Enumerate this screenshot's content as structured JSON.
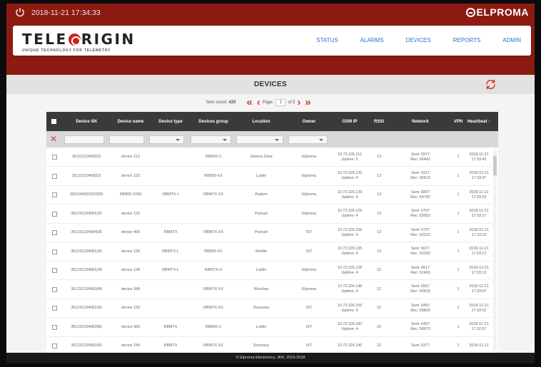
{
  "topbar": {
    "datetime": "2018-11-21 17:34:33",
    "brand": "ELPROMA",
    "colors": {
      "bar": "#8c1a12",
      "accent": "#d6392a",
      "link": "#2a72c8"
    }
  },
  "logo": {
    "name_left": "TELE",
    "name_right": "RIGIN",
    "tagline": "UNIQUE TECHNOLOGY FOR TELEMETRY"
  },
  "nav": [
    "STATUS",
    "ALARMS",
    "DEVICES",
    "REPORTS",
    "ADMIN"
  ],
  "page": {
    "title": "DEVICES"
  },
  "pager": {
    "item_count_label": "Item count:",
    "item_count": "425",
    "page_label": "Page:",
    "page": "1",
    "of": "of 5"
  },
  "table": {
    "headers": [
      "Device SN",
      "Device name",
      "Device type",
      "Devices group",
      "Location",
      "Owner",
      "GSM IP",
      "RSSI",
      "Network",
      "VPN",
      "Heartbeat ↑"
    ],
    "rows": [
      {
        "sn": "351231234582|2",
        "name": "device 212",
        "type": "",
        "group": "RB800-U",
        "location": "Zielona Góra",
        "owner": "Elproma",
        "ip": "10.73.226.112",
        "uptime": "Uptime: 5",
        "rssi": "13",
        "sent": "Sent: 6977",
        "rec": "Rec: 66443",
        "vpn": "1",
        "hb_date": "2018-11-21",
        "hb_time": "17:33:42"
      },
      {
        "sn": "351231234582|3",
        "name": "device 233",
        "type": "",
        "group": "RB800-XX",
        "location": "Lublin",
        "owner": "Elproma",
        "ip": "10.73.226.133",
        "uptime": "Uptime: 4",
        "rssi": "13",
        "sent": "Sent: 6917",
        "rec": "Rec: 65613",
        "vpn": "1",
        "hb_date": "2018-11-21",
        "hb_time": "17:33:37"
      },
      {
        "sn": "3591094621022|99",
        "name": "RB800-2299",
        "type": "RBMTX-I",
        "group": "RBMTX-XX",
        "location": "Radom",
        "owner": "Elproma",
        "ip": "10.73.226.129",
        "uptime": "Uptime: 4",
        "rssi": "13",
        "sent": "Sent: 6857",
        "rec": "Rec: 64783",
        "vpn": "1",
        "hb_date": "2018-11-21",
        "hb_time": "17:33:32"
      },
      {
        "sn": "351231234581|25",
        "name": "device 125",
        "type": "",
        "group": "",
        "location": "Poznań",
        "owner": "Elproma",
        "ip": "10.73.226.125",
        "uptime": "Uptime: 4",
        "rssi": "13",
        "sent": "Sent: 6797",
        "rec": "Rec: 63953",
        "vpn": "1",
        "hb_date": "2018-11-21",
        "hb_time": "17:33:27"
      },
      {
        "sn": "351231234584|06",
        "name": "device 406",
        "type": "RBMTX",
        "group": "RBMTX-XX",
        "location": "Poznań",
        "owner": "IST",
        "ip": "10.73.226.156",
        "uptime": "Uptime: 4",
        "rssi": "13",
        "sent": "Sent: 6737",
        "rec": "Rec: 63123",
        "vpn": "1",
        "hb_date": "2018-11-21",
        "hb_time": "17:33:22"
      },
      {
        "sn": "351231234581|35",
        "name": "device 135",
        "type": "RBMTX-L",
        "group": "RB800-XX",
        "location": "Modlin",
        "owner": "IST",
        "ip": "10.73.226.135",
        "uptime": "Uptime: 4",
        "rssi": "13",
        "sent": "Sent: 6677",
        "rec": "Rec: 62293",
        "vpn": "1",
        "hb_date": "2018-11-21",
        "hb_time": "17:33:17"
      },
      {
        "sn": "351231234581|28",
        "name": "device 128",
        "type": "RBMTX-L",
        "group": "RBMTX-U",
        "location": "Lublin",
        "owner": "Elproma",
        "ip": "10.73.226.128",
        "uptime": "Uptime: 4",
        "rssi": "22",
        "sent": "Sent: 6617",
        "rec": "Rec: 61463",
        "vpn": "1",
        "hb_date": "2018-11-21",
        "hb_time": "17:33:12"
      },
      {
        "sn": "351231234583|48",
        "name": "device 348",
        "type": "",
        "group": "RBMTX-XX",
        "location": "Wrocław",
        "owner": "Elproma",
        "ip": "10.73.226.148",
        "uptime": "Uptime: 4",
        "rssi": "22",
        "sent": "Sent: 6557",
        "rec": "Rec: 60633",
        "vpn": "1",
        "hb_date": "2018-11-21",
        "hb_time": "17:33:07"
      },
      {
        "sn": "351231234581|59",
        "name": "device 159",
        "type": "",
        "group": "RBMTX-XX",
        "location": "Rzeszów",
        "owner": "IST",
        "ip": "10.73.226.109",
        "uptime": "Uptime: 4",
        "rssi": "22",
        "sent": "Sent: 6497",
        "rec": "Rec: 59803",
        "vpn": "1",
        "hb_date": "2018-11-21",
        "hb_time": "17:33:02"
      },
      {
        "sn": "351231234583|83",
        "name": "device 383",
        "type": "RBMTX",
        "group": "RB800-U",
        "location": "Lublin",
        "owner": "IST",
        "ip": "10.73.226.183",
        "uptime": "Uptime: 4",
        "rssi": "22",
        "sent": "Sent: 6437",
        "rec": "Rec: 58973",
        "vpn": "1",
        "hb_date": "2018-11-21",
        "hb_time": "17:32:57"
      },
      {
        "sn": "351231234582|40",
        "name": "device 240",
        "type": "RBMTX",
        "group": "RBMTX-XX",
        "location": "Szamany",
        "owner": "IST",
        "ip": "10.73.226.140",
        "uptime": "",
        "rssi": "22",
        "sent": "Sent: 6377",
        "rec": "",
        "vpn": "1",
        "hb_date": "2018-11-21",
        "hb_time": ""
      }
    ]
  },
  "footer": "© Elproma Electronics, JKK, 2015-2018"
}
